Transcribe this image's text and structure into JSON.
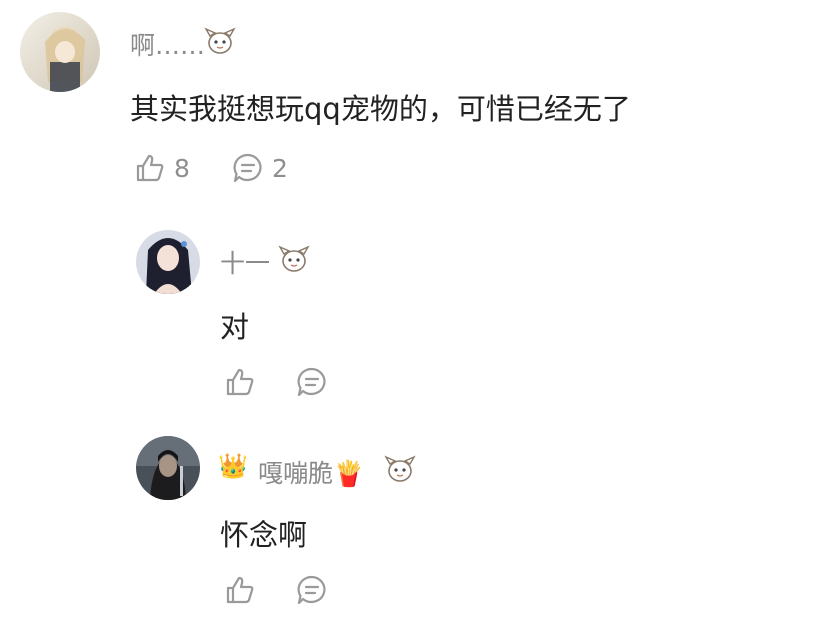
{
  "comments": [
    {
      "username": "啊……",
      "text": "其实我挺想玩qq宠物的，可惜已经无了",
      "like_count": "8",
      "reply_count": "2",
      "avatar_icon": "anime-girl-light-avatar",
      "badge_icon": "cartoon-mascot-badge"
    },
    {
      "username": "十一",
      "text": "对",
      "avatar_icon": "anime-girl-dark-hair-avatar",
      "badge_icon": "cartoon-mascot-badge"
    },
    {
      "username": "嘎嘣脆🍟",
      "text": "怀念啊",
      "avatar_icon": "dark-portrait-avatar",
      "crown_icon": "👑",
      "badge_icon": "cartoon-mascot-badge"
    }
  ],
  "colors": {
    "name": "#8a8a8a",
    "text": "#222222",
    "icon": "#9a9a9a"
  }
}
